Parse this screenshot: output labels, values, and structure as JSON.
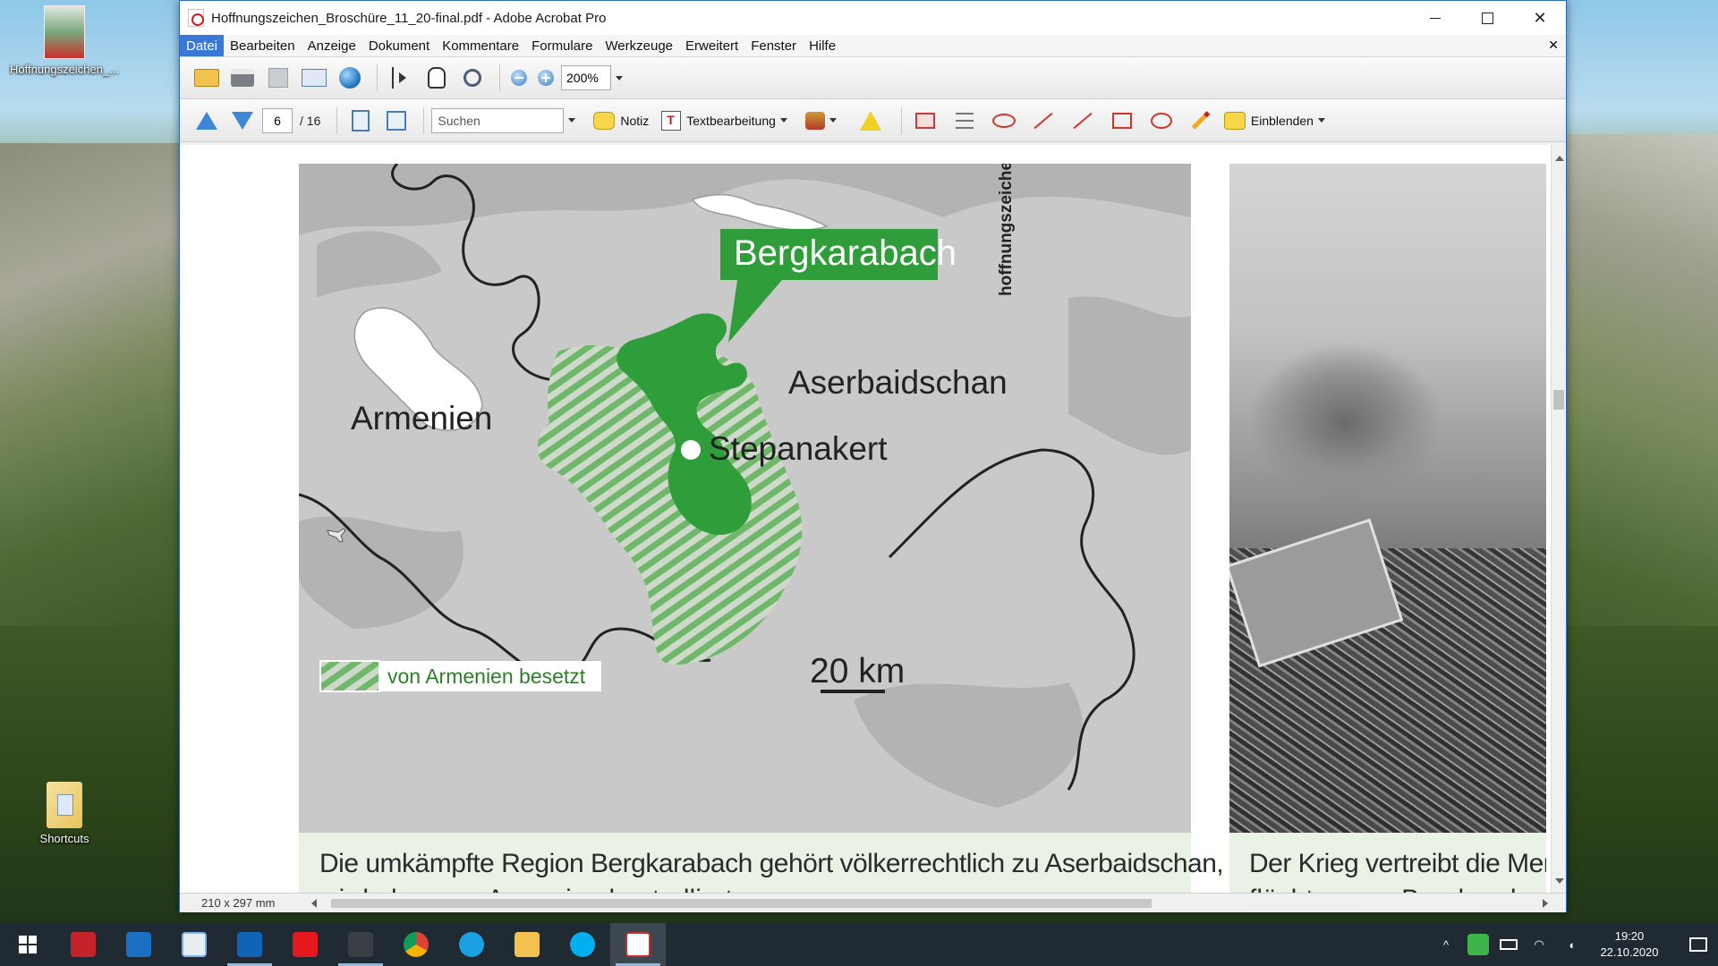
{
  "desktop": {
    "icons": [
      {
        "label": "Hoffnungszeichen_..."
      },
      {
        "label": "Shortcuts"
      }
    ]
  },
  "window": {
    "title": "Hoffnungszeichen_Broschüre_11_20-final.pdf - Adobe Acrobat Pro",
    "controls": {
      "minimize": "–",
      "maximize": "□",
      "close": "✕"
    }
  },
  "menu": {
    "items": [
      "Datei",
      "Bearbeiten",
      "Anzeige",
      "Dokument",
      "Kommentare",
      "Formulare",
      "Werkzeuge",
      "Erweitert",
      "Fenster",
      "Hilfe"
    ],
    "active_index": 0,
    "doc_close": "✕"
  },
  "toolbar1": {
    "zoom": "200%"
  },
  "toolbar2": {
    "page_current": "6",
    "page_total": "/ 16",
    "search_placeholder": "Suchen",
    "note_label": "Notiz",
    "textedit_label": "Textbearbeitung",
    "show_label": "Einblenden"
  },
  "map": {
    "vertical_label": "hoffnungszeichen",
    "region_label": "Bergkarabach",
    "country_az": "Aserbaidschan",
    "country_am": "Armenien",
    "city": "Stepanakert",
    "scale": "20 km",
    "legend": "von Armenien besetzt",
    "colors": {
      "land": "#c9c9c9",
      "dark_land": "#b3b3b3",
      "region": "#2f9e3a",
      "hatch": "#6fb86a",
      "label_bg": "#2f9e3a"
    }
  },
  "captions": {
    "left": "Die umkämpfte Region Bergkarabach gehört völkerrechtlich zu Aserbaidschan,",
    "left_line2": "wird aber von Armenien kontrolliert.",
    "right": "Der Krieg vertreibt die Mens",
    "right_line2": "flüchten aus Bergkarabach."
  },
  "statusbar": {
    "dims": "210 x 297 mm"
  },
  "tray": {
    "time": "19:20",
    "date": "22.10.2020"
  },
  "taskbar": {
    "apps": [
      "start",
      "shield-app",
      "network-app",
      "notepad-app",
      "outlook-app",
      "diasys-app",
      "dark-app",
      "chrome-app",
      "ie-app",
      "explorer-app",
      "skype-app",
      "acrobat-app"
    ]
  }
}
